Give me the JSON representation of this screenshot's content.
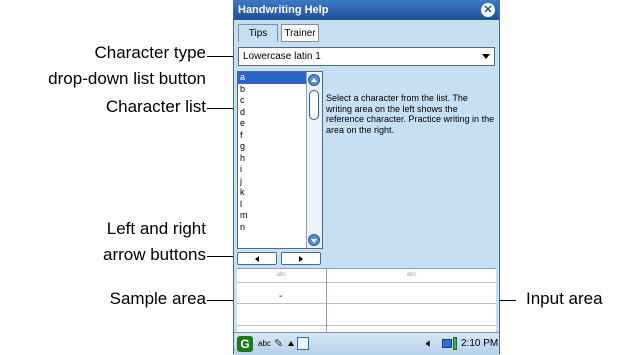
{
  "callouts": {
    "type_line1": "Character type",
    "type_line2": "drop-down list button",
    "list": "Character list",
    "arrows_line1": "Left and right",
    "arrows_line2": "arrow buttons",
    "sample": "Sample area",
    "input": "Input area"
  },
  "window": {
    "title": "Handwriting Help",
    "close_icon": "close-icon"
  },
  "tabs": [
    {
      "label": "Tips"
    },
    {
      "label": "Trainer"
    }
  ],
  "dropdown": {
    "selected": "Lowercase latin 1"
  },
  "character_list": {
    "items": [
      "a",
      "b",
      "c",
      "d",
      "e",
      "f",
      "g",
      "h",
      "i",
      "j",
      "k",
      "l",
      "m",
      "n"
    ],
    "selected_index": 0
  },
  "instructions": "Select a character from the list.  The writing area on the left shows the reference character.  Practice writing in the area on the right.",
  "writing_area": {
    "left_header": "abc",
    "right_header": "abc",
    "sample_char": "-"
  },
  "taskbar": {
    "abc_label": "abc",
    "time": "2:10 PM"
  },
  "colors": {
    "titlebar": "#2a5fb0",
    "panel": "#c6dff2",
    "selection": "#2a66c8"
  }
}
